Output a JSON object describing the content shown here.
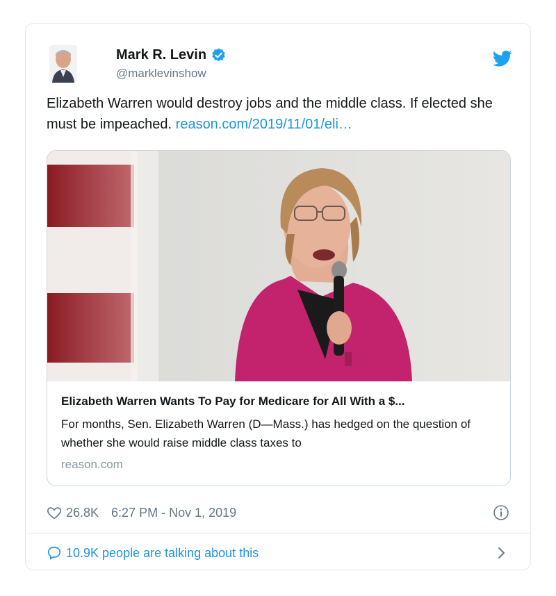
{
  "tweet": {
    "author": {
      "name": "Mark R. Levin",
      "handle": "@marklevinshow",
      "avatar_icon": "author-avatar",
      "verified_icon": "verified-badge-icon"
    },
    "text_plain": "Elizabeth Warren would destroy jobs and the middle class.  If elected she must be impeached. ",
    "text_link": "reason.com/2019/11/01/eli…",
    "link_card": {
      "image_description": "news-photo",
      "title": "Elizabeth Warren Wants To Pay for Medicare for All With a $...",
      "description": "For months, Sen. Elizabeth Warren (D—Mass.) has hedged on the question of whether she would raise middle class taxes to",
      "domain": "reason.com"
    },
    "likes": "26.8K",
    "timestamp": "6:27 PM - Nov 1, 2019",
    "talking": "10.9K people are talking about this"
  },
  "colors": {
    "accent": "#1b95e0",
    "twitter_blue": "#1da1f2",
    "muted": "#657786",
    "border": "#e1e8ed",
    "sweater": "#c2236c"
  }
}
